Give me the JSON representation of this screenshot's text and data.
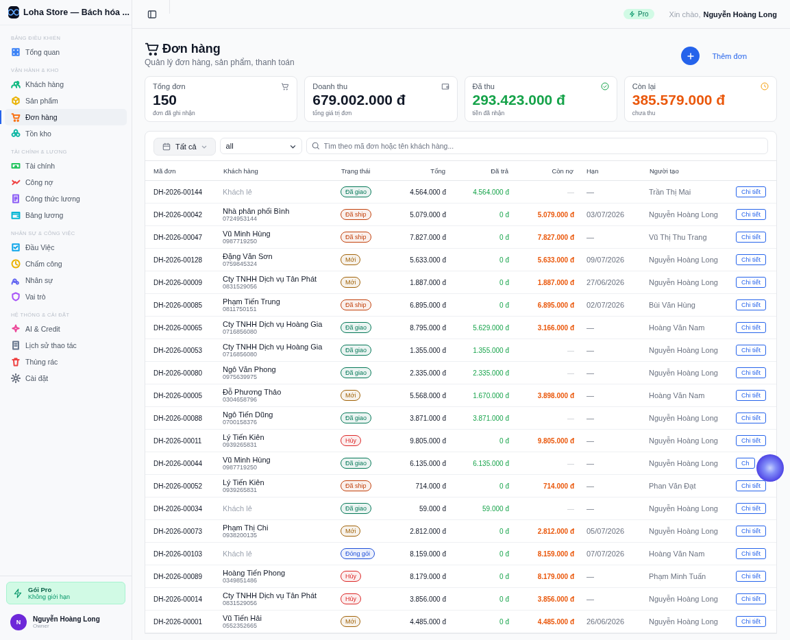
{
  "app": {
    "title": "Loha Store — Bách hóa ..."
  },
  "sidebar": {
    "sections": [
      {
        "title": "BẢNG ĐIỀU KHIỂN",
        "items": [
          {
            "label": "Tổng quan",
            "selected": false,
            "color": "#3b82f6"
          }
        ]
      },
      {
        "title": "VẬN HÀNH & KHO",
        "items": [
          {
            "label": "Khách hàng",
            "selected": false,
            "color": "#10b981"
          },
          {
            "label": "Sản phẩm",
            "selected": false,
            "color": "#eab308"
          },
          {
            "label": "Đơn hàng",
            "selected": true,
            "color": "#f97316"
          },
          {
            "label": "Tồn kho",
            "selected": false,
            "color": "#14b8a6"
          }
        ]
      },
      {
        "title": "TÀI CHÍNH & LƯƠNG",
        "items": [
          {
            "label": "Tài chính",
            "selected": false,
            "color": "#22c55e"
          },
          {
            "label": "Công nợ",
            "selected": false,
            "color": "#ef4444"
          },
          {
            "label": "Công thức lương",
            "selected": false,
            "color": "#8b5cf6"
          },
          {
            "label": "Bảng lương",
            "selected": false,
            "color": "#06b6d4"
          }
        ]
      },
      {
        "title": "NHÂN SỰ & CÔNG VIỆC",
        "items": [
          {
            "label": "Đầu Việc",
            "selected": false,
            "color": "#0ea5e9"
          },
          {
            "label": "Chấm công",
            "selected": false,
            "color": "#eab308"
          },
          {
            "label": "Nhân sự",
            "selected": false,
            "color": "#6366f1"
          },
          {
            "label": "Vai trò",
            "selected": false,
            "color": "#a855f7"
          }
        ]
      },
      {
        "title": "HỆ THỐNG & CÀI ĐẶT",
        "items": [
          {
            "label": "AI & Credit",
            "selected": false,
            "color": "#ec4899"
          },
          {
            "label": "Lịch sử thao tác",
            "selected": false,
            "color": "#64748b"
          },
          {
            "label": "Thùng rác",
            "selected": false,
            "color": "#ef4444"
          },
          {
            "label": "Cài đặt",
            "selected": false,
            "color": "#6b7280"
          }
        ]
      }
    ],
    "plan": {
      "title": "Gói Pro",
      "subtitle": "Không giới hạn"
    },
    "user": {
      "initial": "N",
      "name": "Nguyễn Hoàng Long",
      "role": "Owner"
    }
  },
  "topbar": {
    "badge": "Pro",
    "greeting": "Xin chào,",
    "user": "Nguyễn Hoàng Long"
  },
  "page": {
    "title": "Đơn hàng",
    "subtitle": "Quản lý đơn hàng, sản phẩm, thanh toán",
    "add_button": "Thêm đơn"
  },
  "stats": [
    {
      "label": "Tổng đơn",
      "value": "150",
      "note": "đơn đã ghi nhận",
      "kind": "count"
    },
    {
      "label": "Doanh thu",
      "value": "679.002.000 đ",
      "note": "tổng giá trị đơn",
      "kind": "revenue"
    },
    {
      "label": "Đã thu",
      "value": "293.423.000 đ",
      "note": "tiền đã nhận",
      "kind": "paid"
    },
    {
      "label": "Còn lại",
      "value": "385.579.000 đ",
      "note": "chưa thu",
      "kind": "due"
    }
  ],
  "filters": {
    "period": "Tất cả",
    "status": "all",
    "search_placeholder": "Tìm theo mã đơn hoặc tên khách hàng..."
  },
  "table": {
    "columns": [
      "Mã đơn",
      "Khách hàng",
      "Trạng thái",
      "Tổng",
      "Đã trả",
      "Còn nợ",
      "Hạn",
      "Người tạo"
    ],
    "rows": [
      {
        "id": "DH-2026-00144",
        "customer": "Khách lẻ",
        "walk_in": true,
        "status": {
          "label": "Đã giao",
          "color": "#047857"
        },
        "total": "4.564.000 đ",
        "paid": "4.564.000 đ",
        "due": "—",
        "debt": false,
        "deadline": "—",
        "creator": "Trần Thị Mai",
        "action": "Chi tiết"
      },
      {
        "id": "DH-2026-00042",
        "customer": "Nhà phân phối Bình",
        "phone": "0724953144",
        "walk_in": false,
        "status": {
          "label": "Đã ship",
          "color": "#c2410c"
        },
        "total": "5.079.000 đ",
        "paid": "0 đ",
        "due": "5.079.000 đ",
        "debt": true,
        "deadline": "03/07/2026",
        "creator": "Nguyễn Hoàng Long",
        "action": "Chi tiết"
      },
      {
        "id": "DH-2026-00047",
        "customer": "Vũ Minh Hùng",
        "phone": "0987719250",
        "walk_in": false,
        "status": {
          "label": "Đã ship",
          "color": "#c2410c"
        },
        "total": "7.827.000 đ",
        "paid": "0 đ",
        "due": "7.827.000 đ",
        "debt": true,
        "deadline": "—",
        "creator": "Vũ Thị Thu Trang",
        "action": "Chi tiết"
      },
      {
        "id": "DH-2026-00128",
        "customer": "Đặng Văn Sơn",
        "phone": "0759845324",
        "walk_in": false,
        "status": {
          "label": "Mới",
          "color": "#a16207"
        },
        "total": "5.633.000 đ",
        "paid": "0 đ",
        "due": "5.633.000 đ",
        "debt": true,
        "deadline": "09/07/2026",
        "creator": "Nguyễn Hoàng Long",
        "action": "Chi tiết"
      },
      {
        "id": "DH-2026-00009",
        "customer": "Cty TNHH Dịch vụ Tân Phát",
        "phone": "0831529056",
        "walk_in": false,
        "status": {
          "label": "Mới",
          "color": "#a16207"
        },
        "total": "1.887.000 đ",
        "paid": "0 đ",
        "due": "1.887.000 đ",
        "debt": true,
        "deadline": "27/06/2026",
        "creator": "Nguyễn Hoàng Long",
        "action": "Chi tiết"
      },
      {
        "id": "DH-2026-00085",
        "customer": "Phạm Tiến Trung",
        "phone": "0811750151",
        "walk_in": false,
        "status": {
          "label": "Đã ship",
          "color": "#c2410c"
        },
        "total": "6.895.000 đ",
        "paid": "0 đ",
        "due": "6.895.000 đ",
        "debt": true,
        "deadline": "02/07/2026",
        "creator": "Bùi Văn Hùng",
        "action": "Chi tiết"
      },
      {
        "id": "DH-2026-00065",
        "customer": "Cty TNHH Dịch vụ Hoàng Gia",
        "phone": "0716856080",
        "walk_in": false,
        "status": {
          "label": "Đã giao",
          "color": "#047857"
        },
        "total": "8.795.000 đ",
        "paid": "5.629.000 đ",
        "due": "3.166.000 đ",
        "debt": true,
        "deadline": "—",
        "creator": "Hoàng Văn Nam",
        "action": "Chi tiết"
      },
      {
        "id": "DH-2026-00053",
        "customer": "Cty TNHH Dịch vụ Hoàng Gia",
        "phone": "0716856080",
        "walk_in": false,
        "status": {
          "label": "Đã giao",
          "color": "#047857"
        },
        "total": "1.355.000 đ",
        "paid": "1.355.000 đ",
        "due": "—",
        "debt": false,
        "deadline": "—",
        "creator": "Nguyễn Hoàng Long",
        "action": "Chi tiết"
      },
      {
        "id": "DH-2026-00080",
        "customer": "Ngô Văn Phong",
        "phone": "0975639975",
        "walk_in": false,
        "status": {
          "label": "Đã giao",
          "color": "#047857"
        },
        "total": "2.335.000 đ",
        "paid": "2.335.000 đ",
        "due": "—",
        "debt": false,
        "deadline": "—",
        "creator": "Nguyễn Hoàng Long",
        "action": "Chi tiết"
      },
      {
        "id": "DH-2026-00005",
        "customer": "Đỗ Phương Thảo",
        "phone": "0304658796",
        "walk_in": false,
        "status": {
          "label": "Mới",
          "color": "#a16207"
        },
        "total": "5.568.000 đ",
        "paid": "1.670.000 đ",
        "due": "3.898.000 đ",
        "debt": true,
        "deadline": "—",
        "creator": "Hoàng Văn Nam",
        "action": "Chi tiết"
      },
      {
        "id": "DH-2026-00088",
        "customer": "Ngô Tiến Dũng",
        "phone": "0700158376",
        "walk_in": false,
        "status": {
          "label": "Đã giao",
          "color": "#047857"
        },
        "total": "3.871.000 đ",
        "paid": "3.871.000 đ",
        "due": "—",
        "debt": false,
        "deadline": "—",
        "creator": "Nguyễn Hoàng Long",
        "action": "Chi tiết"
      },
      {
        "id": "DH-2026-00011",
        "customer": "Lý Tiến Kiên",
        "phone": "0939265831",
        "walk_in": false,
        "status": {
          "label": "Hủy",
          "color": "#dc2626"
        },
        "total": "9.805.000 đ",
        "paid": "0 đ",
        "due": "9.805.000 đ",
        "debt": true,
        "deadline": "—",
        "creator": "Nguyễn Hoàng Long",
        "action": "Chi tiết"
      },
      {
        "id": "DH-2026-00044",
        "customer": "Vũ Minh Hùng",
        "phone": "0987719250",
        "walk_in": false,
        "status": {
          "label": "Đã giao",
          "color": "#047857"
        },
        "total": "6.135.000 đ",
        "paid": "6.135.000 đ",
        "due": "—",
        "debt": false,
        "deadline": "—",
        "creator": "Nguyễn Hoàng Long",
        "action": "Ch"
      },
      {
        "id": "DH-2026-00052",
        "customer": "Lý Tiến Kiên",
        "phone": "0939265831",
        "walk_in": false,
        "status": {
          "label": "Đã ship",
          "color": "#c2410c"
        },
        "total": "714.000 đ",
        "paid": "0 đ",
        "due": "714.000 đ",
        "debt": true,
        "deadline": "—",
        "creator": "Phan Văn Đạt",
        "action": "Chi tiết"
      },
      {
        "id": "DH-2026-00034",
        "customer": "Khách lẻ",
        "walk_in": true,
        "status": {
          "label": "Đã giao",
          "color": "#047857"
        },
        "total": "59.000 đ",
        "paid": "59.000 đ",
        "due": "—",
        "debt": false,
        "deadline": "—",
        "creator": "Nguyễn Hoàng Long",
        "action": "Chi tiết"
      },
      {
        "id": "DH-2026-00073",
        "customer": "Phạm Thị Chi",
        "phone": "0938200135",
        "walk_in": false,
        "status": {
          "label": "Mới",
          "color": "#a16207"
        },
        "total": "2.812.000 đ",
        "paid": "0 đ",
        "due": "2.812.000 đ",
        "debt": true,
        "deadline": "05/07/2026",
        "creator": "Nguyễn Hoàng Long",
        "action": "Chi tiết"
      },
      {
        "id": "DH-2026-00103",
        "customer": "Khách lẻ",
        "walk_in": true,
        "status": {
          "label": "Đóng gói",
          "color": "#1d4ed8"
        },
        "total": "8.159.000 đ",
        "paid": "0 đ",
        "due": "8.159.000 đ",
        "debt": true,
        "deadline": "07/07/2026",
        "creator": "Hoàng Văn Nam",
        "action": "Chi tiết"
      },
      {
        "id": "DH-2026-00089",
        "customer": "Hoàng Tiến Phong",
        "phone": "0349851486",
        "walk_in": false,
        "status": {
          "label": "Hủy",
          "color": "#dc2626"
        },
        "total": "8.179.000 đ",
        "paid": "0 đ",
        "due": "8.179.000 đ",
        "debt": true,
        "deadline": "—",
        "creator": "Phạm Minh Tuấn",
        "action": "Chi tiết"
      },
      {
        "id": "DH-2026-00014",
        "customer": "Cty TNHH Dịch vụ Tân Phát",
        "phone": "0831529056",
        "walk_in": false,
        "status": {
          "label": "Hủy",
          "color": "#dc2626"
        },
        "total": "3.856.000 đ",
        "paid": "0 đ",
        "due": "3.856.000 đ",
        "debt": true,
        "deadline": "—",
        "creator": "Nguyễn Hoàng Long",
        "action": "Chi tiết"
      },
      {
        "id": "DH-2026-00001",
        "customer": "Vũ Tiến Hải",
        "phone": "0552352665",
        "walk_in": false,
        "status": {
          "label": "Mới",
          "color": "#a16207"
        },
        "total": "4.485.000 đ",
        "paid": "0 đ",
        "due": "4.485.000 đ",
        "debt": true,
        "deadline": "26/06/2026",
        "creator": "Nguyễn Hoàng Long",
        "action": "Chi tiết"
      }
    ]
  }
}
